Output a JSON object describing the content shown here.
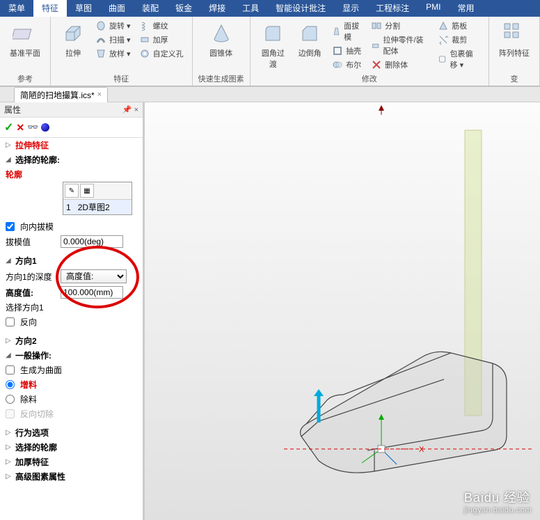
{
  "ribbon": {
    "tabs": [
      "菜单",
      "特征",
      "草图",
      "曲面",
      "装配",
      "钣金",
      "焊接",
      "工具",
      "智能设计批注",
      "显示",
      "工程标注",
      "PMI",
      "常用"
    ],
    "active_tab_index": 1,
    "groups": {
      "reference": {
        "label": "参考",
        "datum_plane": "基准平面"
      },
      "feature": {
        "label": "特征",
        "extrude": "拉伸",
        "rotate": "旋转 ▾",
        "sweep": "扫描 ▾",
        "pattern": "放样 ▾",
        "thread": "螺纹",
        "thicken": "加厚",
        "custom_hole": "自定义孔"
      },
      "quick": {
        "label": "快速生成图素",
        "cone": "圆锥体"
      },
      "modify": {
        "label": "修改",
        "fillet": "圆角过渡",
        "chamfer": "边倒角",
        "face_draft": "面拔模",
        "shell": "抽壳",
        "boolean": "布尔",
        "split": "分割",
        "pull_part": "拉伸零件/装配体",
        "delete_body": "删除体",
        "rib": "筋板",
        "trim": "裁剪",
        "wrap_offset": "包裹偏移 ▾"
      },
      "array": {
        "label": "变",
        "array_feature": "阵列特征"
      }
    }
  },
  "doc_tab": {
    "name": "简陋的扫地撮箕.ics*"
  },
  "panel": {
    "title": "属性",
    "pin_tip": "📌 ×",
    "feature_name": "拉伸特征",
    "contour_section": "选择的轮廓:",
    "contour_label": "轮廓",
    "contour_item": {
      "index": "1",
      "name": "2D草图2"
    },
    "inward_draft": "向内拔模",
    "draft_value_label": "拔模值",
    "draft_value": "0.000(deg)",
    "dir1_section": "方向1",
    "dir1_depth_label": "方向1的深度",
    "dir1_depth_value": "高度值:",
    "height_label": "高度值:",
    "height_value": "100.000(mm)",
    "select_dir1": "选择方向1",
    "reverse": "反向",
    "dir2_section": "方向2",
    "general_op": "一般操作:",
    "gen_as_surface": "生成为曲面",
    "add_material": "增料",
    "remove_material": "除料",
    "reverse_cut": "反向切除",
    "behavior_options": "行为选项",
    "select_contour": "选择的轮廓",
    "thicken_feature": "加厚特征",
    "advanced_props": "高级图素属性"
  },
  "watermark": {
    "main": "Baidu 经验",
    "sub": "jingyan.baidu.com"
  }
}
